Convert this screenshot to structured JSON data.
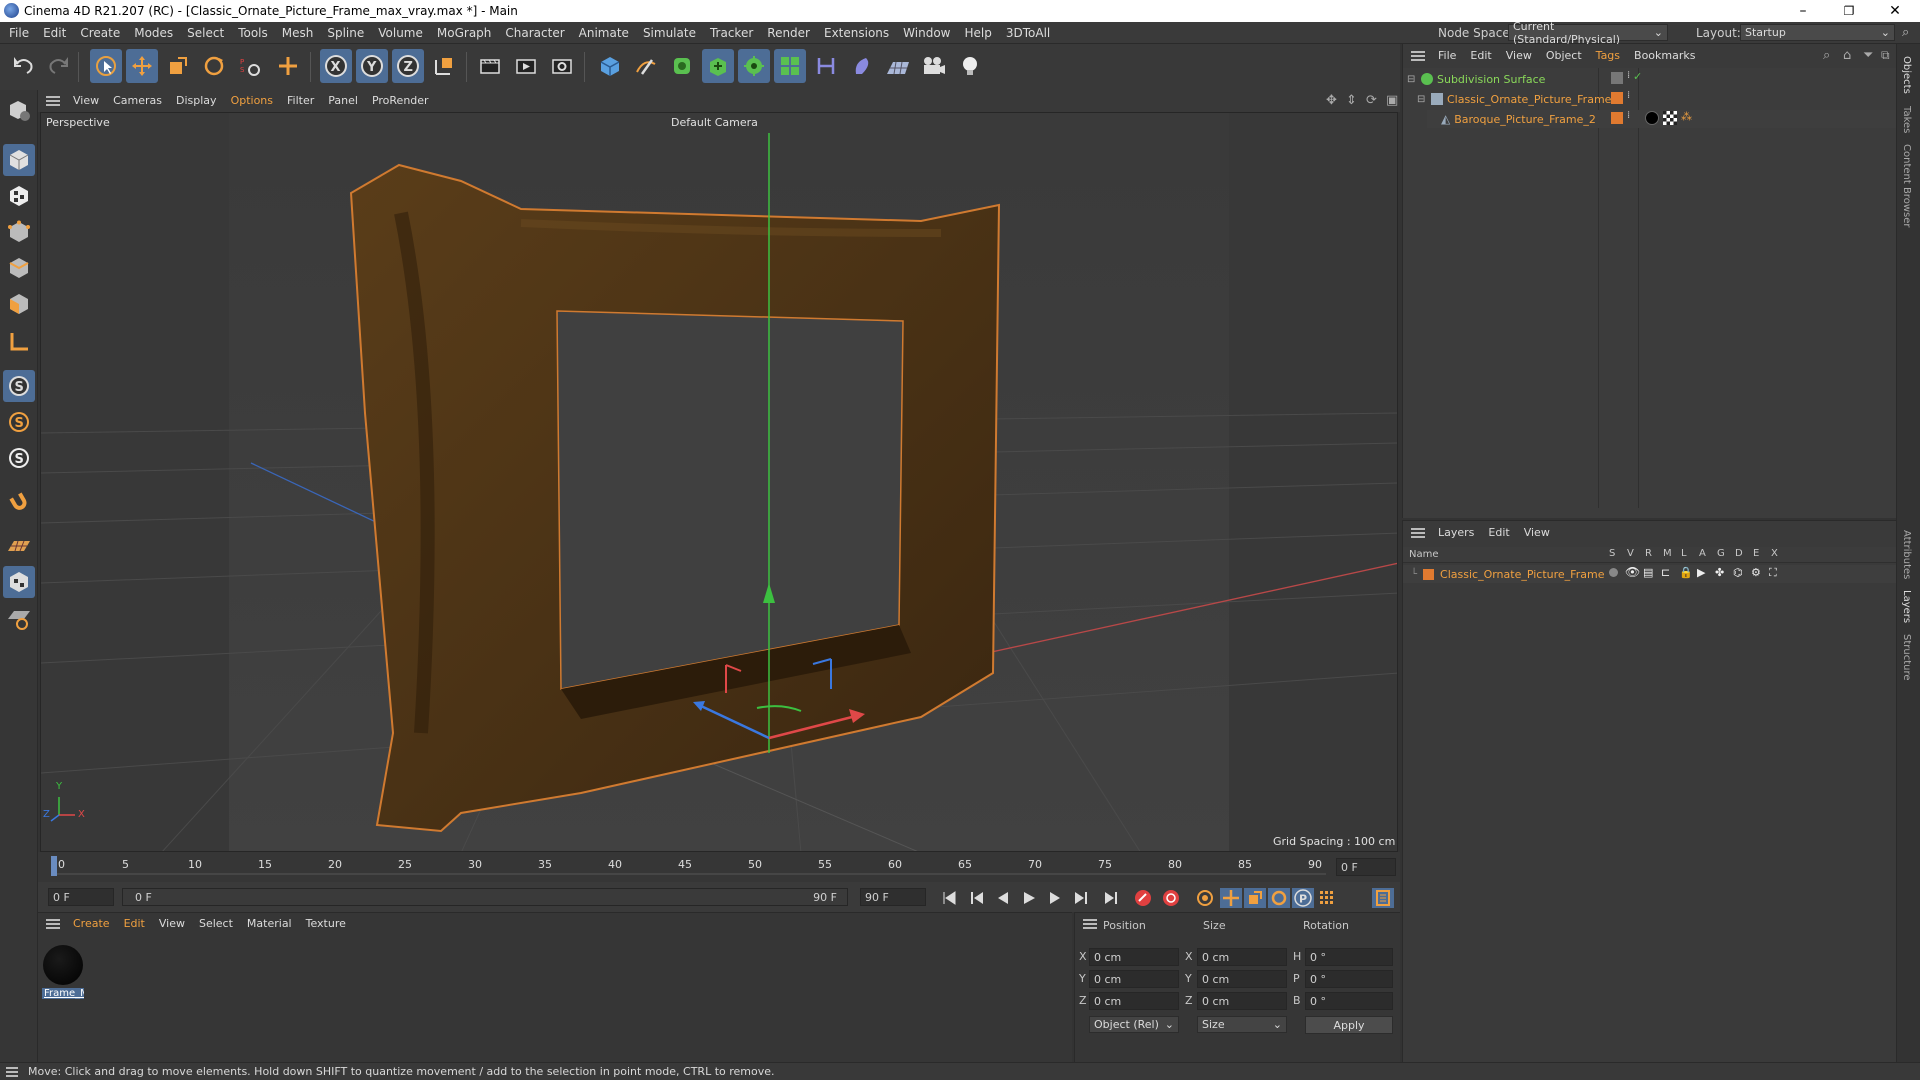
{
  "window": {
    "title": "Cinema 4D R21.207 (RC) - [Classic_Ornate_Picture_Frame_max_vray.max *] - Main",
    "minimize": "–",
    "restore": "❐",
    "close": "✕"
  },
  "menubar": {
    "items": [
      "File",
      "Edit",
      "Create",
      "Modes",
      "Select",
      "Tools",
      "Mesh",
      "Spline",
      "Volume",
      "MoGraph",
      "Character",
      "Animate",
      "Simulate",
      "Tracker",
      "Render",
      "Extensions",
      "Window",
      "Help",
      "3DToAll"
    ],
    "node_space_label": "Node Space:",
    "node_space_value": "Current (Standard/Physical)",
    "layout_label": "Layout:",
    "layout_value": "Startup"
  },
  "viewport": {
    "menu": [
      "View",
      "Cameras",
      "Display",
      "Options",
      "Filter",
      "Panel",
      "ProRender"
    ],
    "label": "Perspective",
    "camera": "Default Camera",
    "grid_spacing": "Grid Spacing : 100 cm",
    "axis_y": "Y",
    "axis_x": "X",
    "axis_z": "Z"
  },
  "timeline": {
    "ticks": [
      "0",
      "5",
      "10",
      "15",
      "20",
      "25",
      "30",
      "35",
      "40",
      "45",
      "50",
      "55",
      "60",
      "65",
      "70",
      "75",
      "80",
      "85",
      "90"
    ],
    "current_frame_right": "0 F",
    "start_field": "0 F",
    "range_start": "0 F",
    "range_end": "90 F",
    "end_field": "90 F"
  },
  "material_panel": {
    "menu": [
      "Create",
      "Edit",
      "View",
      "Select",
      "Material",
      "Texture"
    ],
    "material_name": "Frame_M"
  },
  "coords": {
    "headers": [
      "Position",
      "Size",
      "Rotation"
    ],
    "rows": [
      {
        "axis": "X",
        "pos": "0 cm",
        "size_axis": "X",
        "size": "0 cm",
        "rot_axis": "H",
        "rot": "0 °"
      },
      {
        "axis": "Y",
        "pos": "0 cm",
        "size_axis": "Y",
        "size": "0 cm",
        "rot_axis": "P",
        "rot": "0 °"
      },
      {
        "axis": "Z",
        "pos": "0 cm",
        "size_axis": "Z",
        "size": "0 cm",
        "rot_axis": "B",
        "rot": "0 °"
      }
    ],
    "mode": "Object (Rel)",
    "size_mode": "Size",
    "apply": "Apply"
  },
  "objects_panel": {
    "menu": [
      "File",
      "Edit",
      "View",
      "Object",
      "Tags",
      "Bookmarks"
    ],
    "items": [
      {
        "name": "Subdivision Surface",
        "color": "#8ad85a"
      },
      {
        "name": "Classic_Ornate_Picture_Frame",
        "color": "#f0a040"
      },
      {
        "name": "Baroque_Picture_Frame_2",
        "color": "#f0a040"
      }
    ]
  },
  "layers_panel": {
    "menu": [
      "Layers",
      "Edit",
      "View"
    ],
    "name_header": "Name",
    "columns": [
      "S",
      "V",
      "R",
      "M",
      "L",
      "A",
      "G",
      "D",
      "E",
      "X"
    ],
    "layer_name": "Classic_Ornate_Picture_Frame",
    "layer_color": "#e07a30"
  },
  "side_tabs": [
    "Objects",
    "Takes",
    "Content Browser",
    "Attributes",
    "Layers",
    "Structure"
  ],
  "status": "Move: Click and drag to move elements. Hold down SHIFT to quantize movement / add to the selection in point mode, CTRL to remove.",
  "colors": {
    "accent": "#4d6d96",
    "frame_wood": "#4a3215",
    "frame_edge": "#d07a30"
  }
}
